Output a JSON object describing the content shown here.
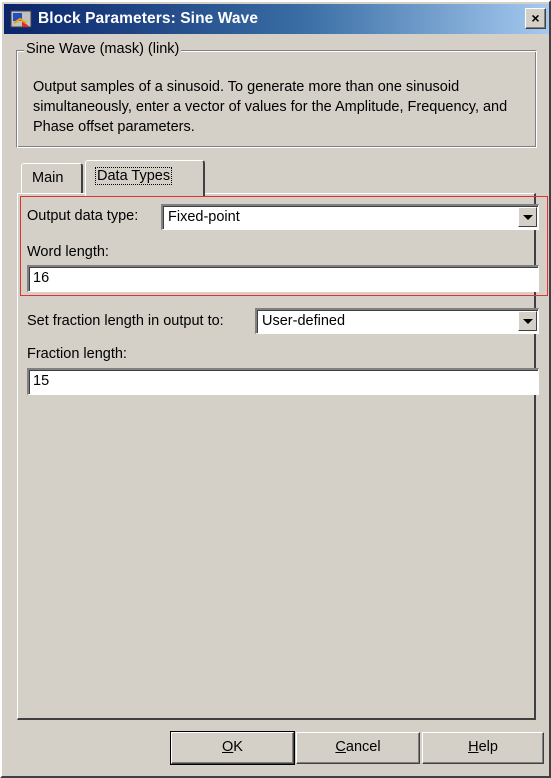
{
  "window": {
    "title": "Block Parameters: Sine Wave",
    "close_glyph": "×"
  },
  "group": {
    "legend": "Sine Wave (mask) (link)",
    "description": "Output samples of a sinusoid.  To generate more than one sinusoid simultaneously, enter a vector of values for the Amplitude, Frequency, and Phase offset parameters."
  },
  "tabs": [
    {
      "label": "Main",
      "selected": false
    },
    {
      "label": "Data Types",
      "selected": true
    }
  ],
  "fields": {
    "output_data_type": {
      "label": "Output data type:",
      "value": "Fixed-point"
    },
    "word_length": {
      "label": "Word length:",
      "value": "16"
    },
    "fraction_mode": {
      "label": "Set fraction length in output to:",
      "value": "User-defined"
    },
    "fraction_length": {
      "label": "Fraction length:",
      "value": "15"
    }
  },
  "buttons": {
    "ok": {
      "mnemonic": "O",
      "rest": "K"
    },
    "cancel": {
      "mnemonic": "C",
      "rest": "ancel"
    },
    "help": {
      "mnemonic": "H",
      "rest": "elp"
    }
  },
  "colors": {
    "highlight": "#e0302f",
    "title_gradient_start": "#0a246a",
    "title_gradient_end": "#a6caf0",
    "face": "#d4d0c8"
  },
  "icons": {
    "window_icon": "simulink-block-icon",
    "dropdown": "chevron-down-icon"
  }
}
